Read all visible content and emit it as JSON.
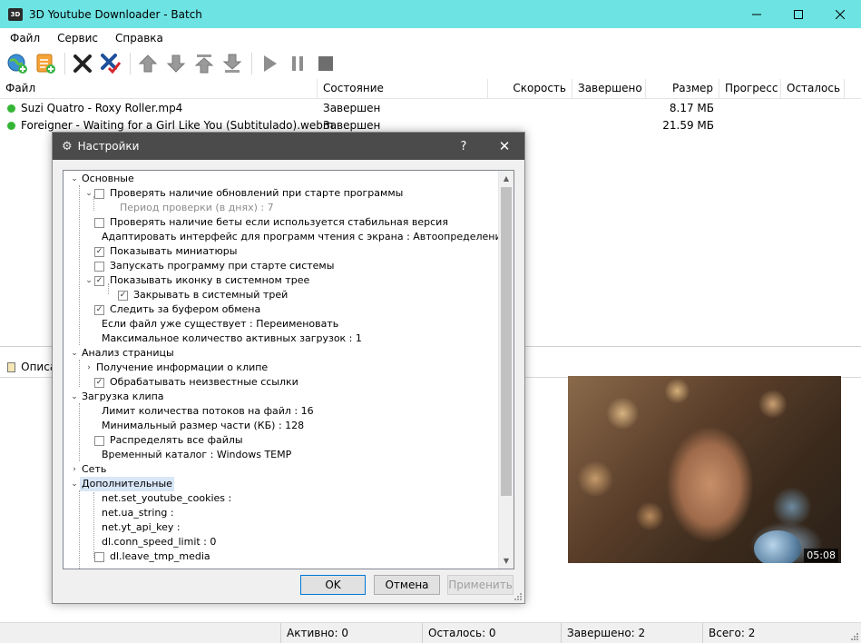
{
  "window": {
    "title": "3D Youtube Downloader - Batch",
    "icon_label": "3D"
  },
  "menu": [
    "Файл",
    "Сервис",
    "Справка"
  ],
  "table": {
    "columns": [
      "Файл",
      "Состояние",
      "Скорость",
      "Завершено",
      "Размер",
      "Прогресс",
      "Осталось"
    ],
    "rows": [
      {
        "file": "Suzi Quatro - Roxy Roller.mp4",
        "status": "Завершен",
        "size": "8.17 МБ"
      },
      {
        "file": "Foreigner - Waiting for a Girl Like You (Subtitulado).webm",
        "status": "Завершен",
        "size": "21.59 МБ"
      }
    ]
  },
  "description_tab": "Описание",
  "video": {
    "duration": "05:08"
  },
  "statusbar": {
    "active": "Активно: 0",
    "remaining": "Осталось: 0",
    "completed": "Завершено: 2",
    "total": "Всего: 2"
  },
  "dialog": {
    "title": "Настройки",
    "help": "?",
    "close": "✕",
    "tree": [
      "Основные",
      "Проверять наличие обновлений при старте программы",
      "Период проверки (в днях) : 7",
      "Проверять наличие беты если используется стабильная версия",
      "Адаптировать интерфейс для программ чтения с экрана : Автоопределение",
      "Показывать миниатюры",
      "Запускать программу при старте системы",
      "Показывать иконку в системном трее",
      "Закрывать в системный трей",
      "Следить за буфером обмена",
      "Если файл уже существует : Переименовать",
      "Максимальное количество активных загрузок : 1",
      "Анализ страницы",
      "Получение информации о клипе",
      "Обрабатывать неизвестные ссылки",
      "Загрузка клипа",
      "Лимит количества потоков на файл : 16",
      "Минимальный размер части (КБ) : 128",
      "Распределять все файлы",
      "Временный каталог : Windows TEMP",
      "Сеть",
      "Дополнительные",
      "net.set_youtube_cookies :",
      "net.ua_string :",
      "net.yt_api_key :",
      "dl.conn_speed_limit : 0",
      "dl.leave_tmp_media"
    ],
    "buttons": {
      "ok": "OK",
      "cancel": "Отмена",
      "apply": "Применить"
    }
  },
  "colors": {
    "titlebar": "#6ee3e3",
    "status_ok": "#35b535",
    "dialog_titlebar": "#4b4b4b"
  }
}
